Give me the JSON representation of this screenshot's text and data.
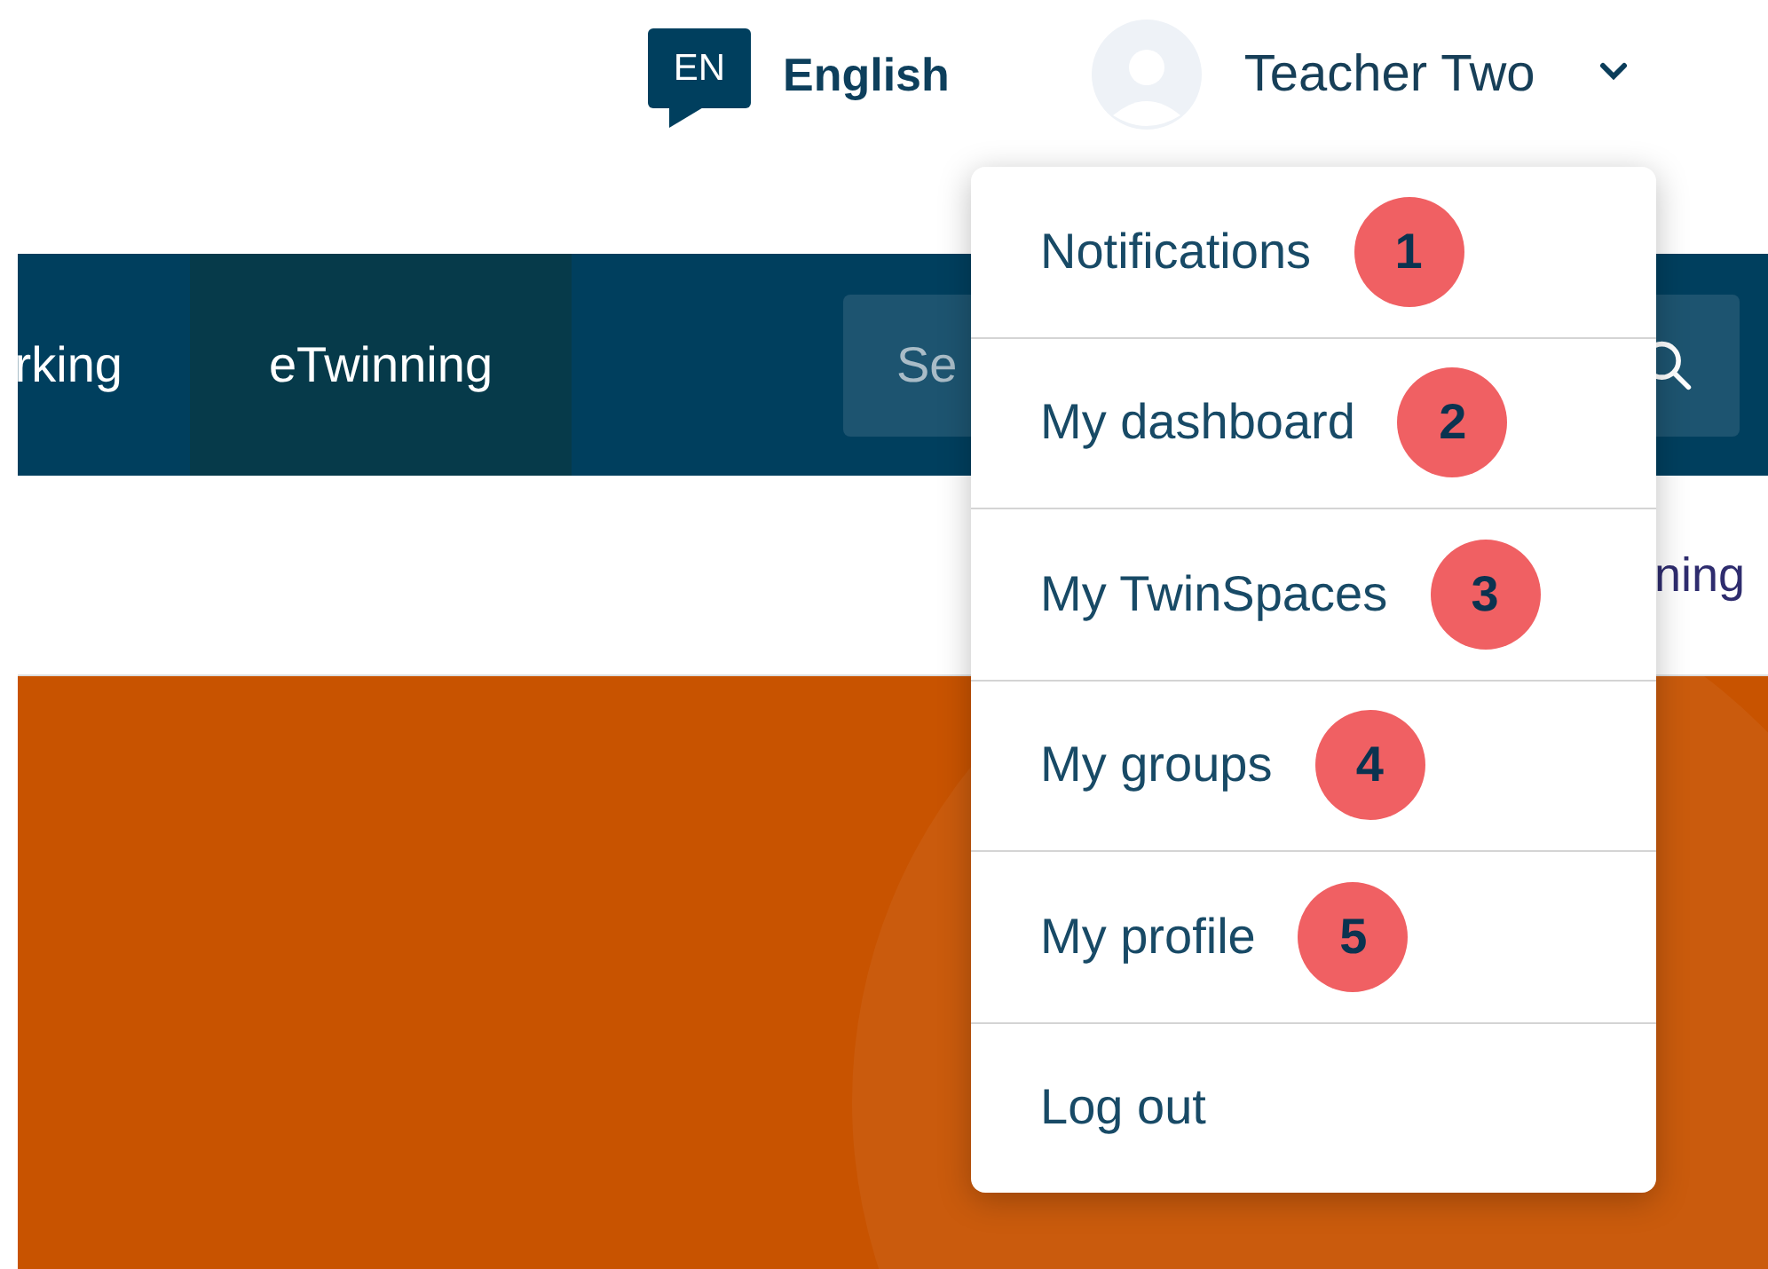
{
  "header": {
    "language": {
      "code": "EN",
      "label": "English"
    },
    "user": {
      "name": "Teacher Two"
    }
  },
  "nav": {
    "tabs": [
      {
        "label": "rking",
        "selected": false
      },
      {
        "label": "eTwinning",
        "selected": true
      }
    ],
    "search": {
      "placeholder": "Se"
    }
  },
  "breadcrumb": {
    "text": "ning"
  },
  "user_menu": {
    "items": [
      {
        "label": "Notifications",
        "badge": "1"
      },
      {
        "label": "My dashboard",
        "badge": "2"
      },
      {
        "label": "My TwinSpaces",
        "badge": "3"
      },
      {
        "label": "My groups",
        "badge": "4"
      },
      {
        "label": "My profile",
        "badge": "5"
      },
      {
        "label": "Log out"
      }
    ]
  }
}
